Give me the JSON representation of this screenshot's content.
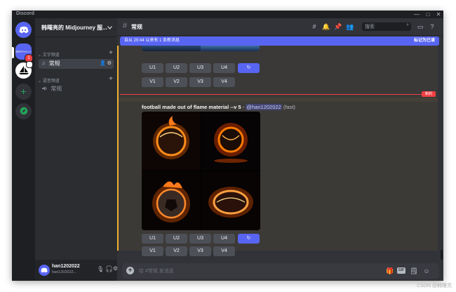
{
  "window": {
    "brand": "Discord",
    "controls": [
      "—",
      "□",
      "✕"
    ]
  },
  "servers": {
    "active_label": "韩曙亮的Midjourney服务器",
    "badge": "1"
  },
  "sidebar": {
    "server_name": "韩曙亮的 Midjourney 服...",
    "text_category": "文字频道",
    "text_channel": "常规",
    "voice_category": "语音频道",
    "voice_channel": "常规"
  },
  "user": {
    "name": "han1202022",
    "tag": "han1202022..."
  },
  "header": {
    "channel": "常规",
    "search_placeholder": "搜索"
  },
  "new_messages": {
    "text": "自从 20:44 以来有 1 条新消息",
    "action": "标记为已读"
  },
  "messages": {
    "prev_u": [
      "U1",
      "U2",
      "U3",
      "U4"
    ],
    "prev_v": [
      "V1",
      "V2",
      "V3",
      "V4"
    ],
    "divider_badge": "新的",
    "prompt_text": "football made out of flame material --v 5",
    "mention": "@han1202022",
    "speed": "(fast)",
    "u_buttons": [
      "U1",
      "U2",
      "U3",
      "U4"
    ],
    "v_buttons": [
      "V1",
      "V2",
      "V3",
      "V4"
    ]
  },
  "composer": {
    "placeholder": "给 #常规 发消息",
    "gif": "GIF"
  },
  "watermark": "CSDN @韩曙亮",
  "colors": {
    "accent": "#5865f2",
    "new_divider": "#f23f43",
    "highlight": "#f0b232"
  }
}
